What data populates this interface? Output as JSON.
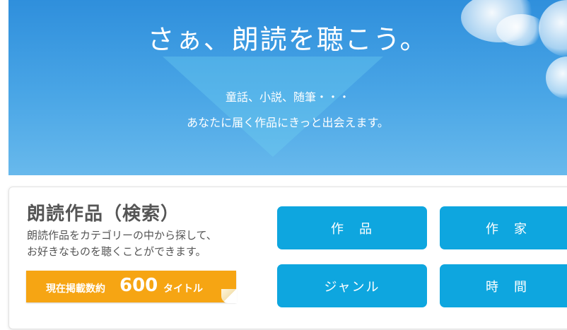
{
  "hero": {
    "title": "さぁ、朗読を聴こう。",
    "subtitle_line1": "童話、小説、随筆・・・",
    "subtitle_line2": "あなたに届く作品にきっと出会えます。"
  },
  "search": {
    "title": "朗読作品（検索）",
    "description_line1": "朗読作品をカテゴリーの中から探して、",
    "description_line2": "お好きなものを聴くことができます。",
    "count": {
      "prefix": "現在掲載数約",
      "number": "600",
      "suffix": "タイトル"
    }
  },
  "categories": {
    "works": "作　品",
    "authors": "作　家",
    "genre": "ジャンル",
    "time": "時　間"
  },
  "colors": {
    "sky": "#3a9be2",
    "button": "#0ea6df",
    "badge": "#f6a513",
    "text": "#555555"
  }
}
